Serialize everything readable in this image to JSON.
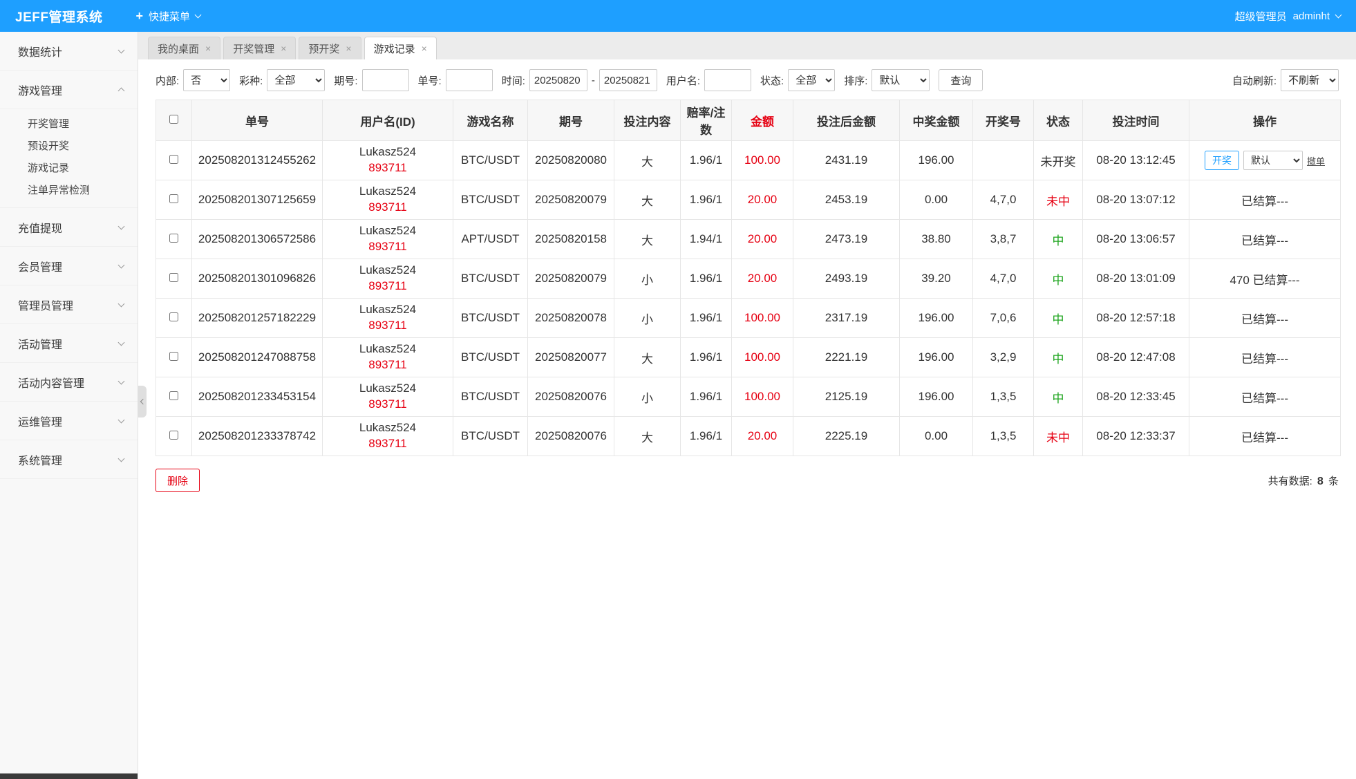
{
  "theme": {
    "accent": "#1e9fff",
    "red": "#e60012",
    "green": "#1fa51f"
  },
  "topbar": {
    "logo": "JEFF管理系统",
    "quick_menu": "快捷菜单",
    "role": "超级管理员",
    "username": "adminht"
  },
  "sidebar": {
    "items": [
      {
        "label": "数据统计"
      },
      {
        "label": "游戏管理",
        "children": [
          "开奖管理",
          "预设开奖",
          "游戏记录",
          "注单异常检测"
        ]
      },
      {
        "label": "充值提现"
      },
      {
        "label": "会员管理"
      },
      {
        "label": "管理员管理"
      },
      {
        "label": "活动管理"
      },
      {
        "label": "活动内容管理"
      },
      {
        "label": "运维管理"
      },
      {
        "label": "系统管理"
      }
    ]
  },
  "tabs": [
    {
      "label": "我的桌面"
    },
    {
      "label": "开奖管理"
    },
    {
      "label": "预开奖"
    },
    {
      "label": "游戏记录"
    }
  ],
  "filters": {
    "internal_label": "内部:",
    "internal_value": "否",
    "lottery_label": "彩种:",
    "lottery_value": "全部",
    "issue_label": "期号:",
    "order_label": "单号:",
    "time_label": "时间:",
    "time_from": "20250820",
    "time_sep": "-",
    "time_to": "20250821",
    "username_label": "用户名:",
    "status_label": "状态:",
    "status_value": "全部",
    "sort_label": "排序:",
    "sort_value": "默认",
    "search_button": "查询",
    "auto_refresh_label": "自动刷新:",
    "auto_refresh_value": "不刷新"
  },
  "table": {
    "headers": [
      "单号",
      "用户名(ID)",
      "游戏名称",
      "期号",
      "投注内容",
      "赔率/注数",
      "金额",
      "投注后金额",
      "中奖金额",
      "开奖号",
      "状态",
      "投注时间",
      "操作"
    ],
    "rows": [
      {
        "order_no": "202508201312455262",
        "username": "Lukasz524",
        "user_id": "893711",
        "game": "BTC/USDT",
        "issue": "20250820080",
        "bet": "大",
        "odds": "1.96/1",
        "amount": "100.00",
        "after_amount": "2431.19",
        "win_amount": "196.00",
        "draw_no": "",
        "status": "未开奖",
        "status_type": "pending",
        "bet_time": "08-20 13:12:45",
        "action_draw": "开奖",
        "action_select": "默认",
        "action_cancel": "撤单"
      },
      {
        "order_no": "202508201307125659",
        "username": "Lukasz524",
        "user_id": "893711",
        "game": "BTC/USDT",
        "issue": "20250820079",
        "bet": "大",
        "odds": "1.96/1",
        "amount": "20.00",
        "after_amount": "2453.19",
        "win_amount": "0.00",
        "draw_no": "4,7,0",
        "status": "未中",
        "status_type": "lose",
        "bet_time": "08-20 13:07:12",
        "action_text": "已结算---"
      },
      {
        "order_no": "202508201306572586",
        "username": "Lukasz524",
        "user_id": "893711",
        "game": "APT/USDT",
        "issue": "20250820158",
        "bet": "大",
        "odds": "1.94/1",
        "amount": "20.00",
        "after_amount": "2473.19",
        "win_amount": "38.80",
        "draw_no": "3,8,7",
        "status": "中",
        "status_type": "win",
        "bet_time": "08-20 13:06:57",
        "action_text": "已结算---"
      },
      {
        "order_no": "202508201301096826",
        "username": "Lukasz524",
        "user_id": "893711",
        "game": "BTC/USDT",
        "issue": "20250820079",
        "bet": "小",
        "odds": "1.96/1",
        "amount": "20.00",
        "after_amount": "2493.19",
        "win_amount": "39.20",
        "draw_no": "4,7,0",
        "status": "中",
        "status_type": "win",
        "bet_time": "08-20 13:01:09",
        "action_text": "470 已结算---"
      },
      {
        "order_no": "202508201257182229",
        "username": "Lukasz524",
        "user_id": "893711",
        "game": "BTC/USDT",
        "issue": "20250820078",
        "bet": "小",
        "odds": "1.96/1",
        "amount": "100.00",
        "after_amount": "2317.19",
        "win_amount": "196.00",
        "draw_no": "7,0,6",
        "status": "中",
        "status_type": "win",
        "bet_time": "08-20 12:57:18",
        "action_text": "已结算---"
      },
      {
        "order_no": "202508201247088758",
        "username": "Lukasz524",
        "user_id": "893711",
        "game": "BTC/USDT",
        "issue": "20250820077",
        "bet": "大",
        "odds": "1.96/1",
        "amount": "100.00",
        "after_amount": "2221.19",
        "win_amount": "196.00",
        "draw_no": "3,2,9",
        "status": "中",
        "status_type": "win",
        "bet_time": "08-20 12:47:08",
        "action_text": "已结算---"
      },
      {
        "order_no": "202508201233453154",
        "username": "Lukasz524",
        "user_id": "893711",
        "game": "BTC/USDT",
        "issue": "20250820076",
        "bet": "小",
        "odds": "1.96/1",
        "amount": "100.00",
        "after_amount": "2125.19",
        "win_amount": "196.00",
        "draw_no": "1,3,5",
        "status": "中",
        "status_type": "win",
        "bet_time": "08-20 12:33:45",
        "action_text": "已结算---"
      },
      {
        "order_no": "202508201233378742",
        "username": "Lukasz524",
        "user_id": "893711",
        "game": "BTC/USDT",
        "issue": "20250820076",
        "bet": "大",
        "odds": "1.96/1",
        "amount": "20.00",
        "after_amount": "2225.19",
        "win_amount": "0.00",
        "draw_no": "1,3,5",
        "status": "未中",
        "status_type": "lose",
        "bet_time": "08-20 12:33:37",
        "action_text": "已结算---"
      }
    ]
  },
  "footer": {
    "delete_button": "删除",
    "total_label": "共有数据:",
    "total_count": "8",
    "total_unit": "条"
  }
}
